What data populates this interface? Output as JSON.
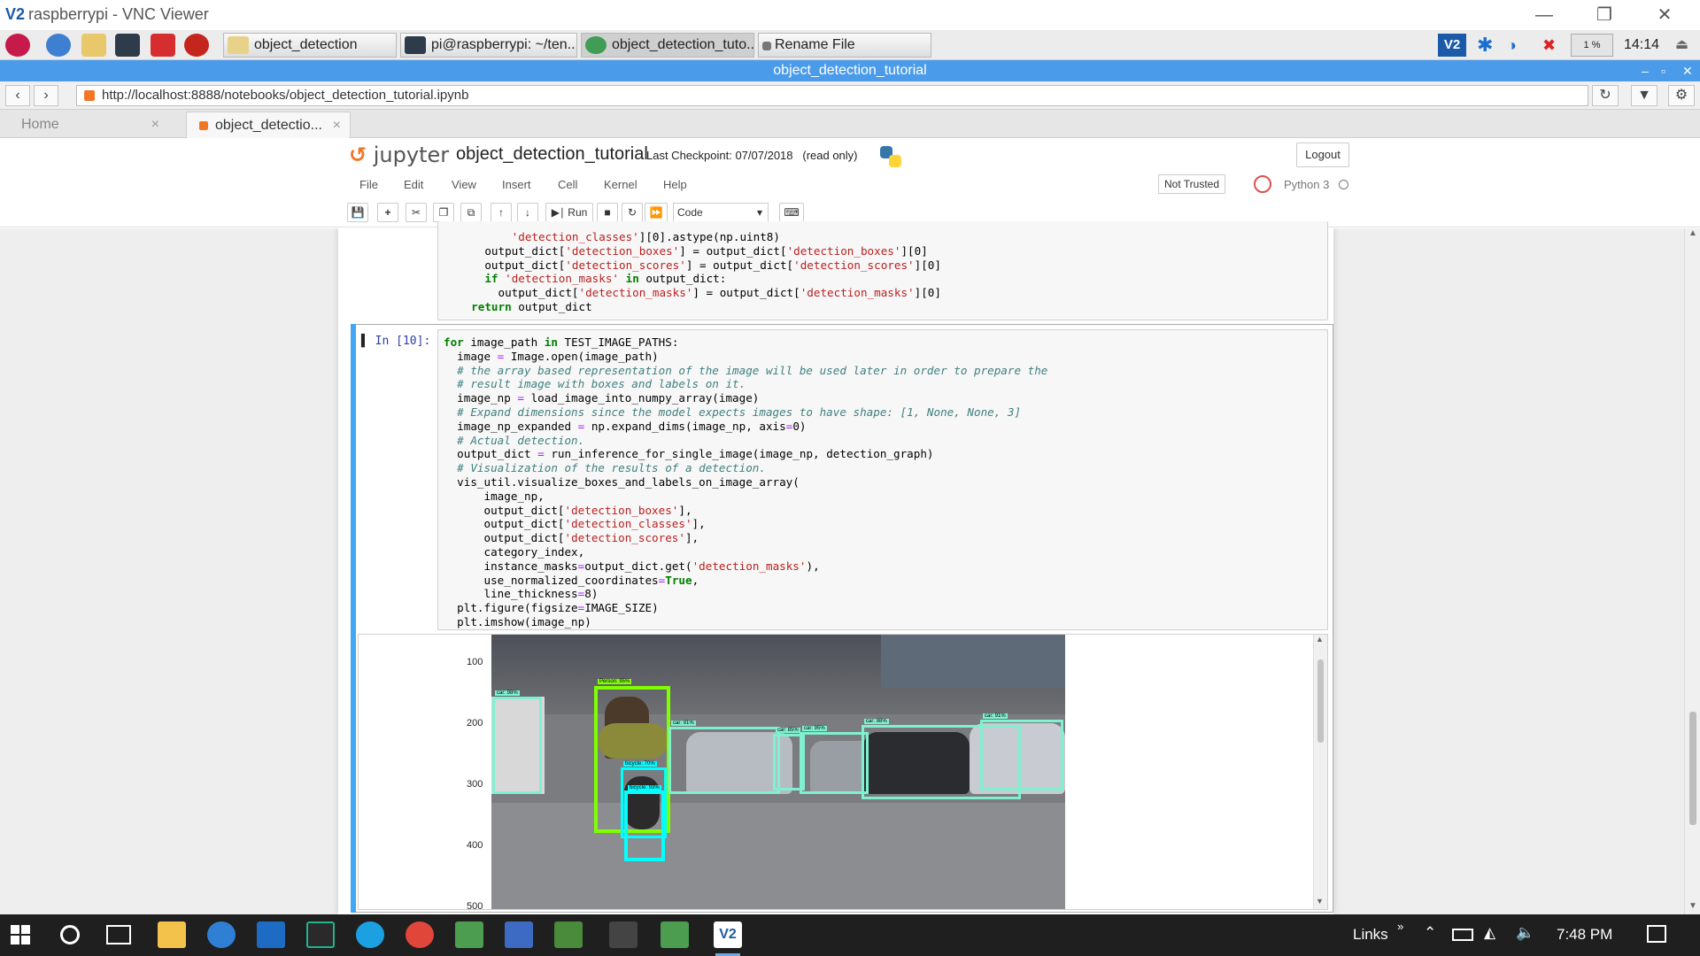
{
  "vnc": {
    "title": "raspberrypi - VNC Viewer",
    "logo": "V2"
  },
  "pi_taskbar": {
    "tasks": [
      {
        "label": "object_detection",
        "icon": "folder-icon"
      },
      {
        "label": "pi@raspberrypi: ~/ten...",
        "icon": "terminal-icon"
      },
      {
        "label": "object_detection_tuto...",
        "icon": "browser-icon"
      },
      {
        "label": "Rename File",
        "icon": "dialog-icon"
      }
    ],
    "cpu": "1 %",
    "clock": "14:14"
  },
  "browser": {
    "window_title": "object_detection_tutorial",
    "url": "http://localhost:8888/notebooks/object_detection_tutorial.ipynb",
    "tabs": [
      {
        "label": "Home"
      },
      {
        "label": "object_detectio..."
      }
    ]
  },
  "jupyter": {
    "logo": "jupyter",
    "notebook_name": "object_detection_tutorial",
    "checkpoint": "Last Checkpoint: 07/07/2018",
    "read_only": "(read only)",
    "logout": "Logout",
    "menu": [
      "File",
      "Edit",
      "View",
      "Insert",
      "Cell",
      "Kernel",
      "Help"
    ],
    "not_trusted": "Not Trusted",
    "kernel": "Python 3",
    "toolbar": {
      "run": "Run",
      "cell_type": "Code"
    }
  },
  "cell_prev_lines": [
    [
      [
        "",
        "        ",
        ""
      ],
      [
        "s",
        "'detection_classes'"
      ],
      [
        "",
        "][0].astype(np.uint8)"
      ]
    ],
    [
      [
        "",
        "    output_dict["
      ],
      [
        "s",
        "'detection_boxes'"
      ],
      [
        "",
        "] = output_dict["
      ],
      [
        "s",
        "'detection_boxes'"
      ],
      [
        "",
        "][0]"
      ]
    ],
    [
      [
        "",
        "    output_dict["
      ],
      [
        "s",
        "'detection_scores'"
      ],
      [
        "",
        "] = output_dict["
      ],
      [
        "s",
        "'detection_scores'"
      ],
      [
        "",
        "][0]"
      ]
    ],
    [
      [
        "",
        "    "
      ],
      [
        "k",
        "if"
      ],
      [
        "",
        " "
      ],
      [
        "s",
        "'detection_masks'"
      ],
      [
        "",
        " "
      ],
      [
        "k",
        "in"
      ],
      [
        "",
        " output_dict:"
      ]
    ],
    [
      [
        "",
        "      output_dict["
      ],
      [
        "s",
        "'detection_masks'"
      ],
      [
        "",
        "] = output_dict["
      ],
      [
        "s",
        "'detection_masks'"
      ],
      [
        "",
        "][0]"
      ]
    ],
    [
      [
        "",
        "  "
      ],
      [
        "k",
        "return"
      ],
      [
        "",
        " output_dict"
      ]
    ]
  ],
  "cell_current": {
    "prompt": "In [10]:",
    "lines": [
      [
        [
          "k",
          "for"
        ],
        [
          "",
          " image_path "
        ],
        [
          "k",
          "in"
        ],
        [
          "",
          " TEST_IMAGE_PATHS:"
        ]
      ],
      [
        [
          "",
          "  image "
        ],
        [
          "o",
          "="
        ],
        [
          "",
          " Image.open(image_path)"
        ]
      ],
      [
        [
          "c",
          "  # the array based representation of the image will be used later in order to prepare the"
        ]
      ],
      [
        [
          "c",
          "  # result image with boxes and labels on it."
        ]
      ],
      [
        [
          "",
          "  image_np "
        ],
        [
          "o",
          "="
        ],
        [
          "",
          " load_image_into_numpy_array(image)"
        ]
      ],
      [
        [
          "c",
          "  # Expand dimensions since the model expects images to have shape: [1, None, None, 3]"
        ]
      ],
      [
        [
          "",
          "  image_np_expanded "
        ],
        [
          "o",
          "="
        ],
        [
          "",
          " np.expand_dims(image_np, axis"
        ],
        [
          "o",
          "="
        ],
        [
          "",
          "0)"
        ]
      ],
      [
        [
          "c",
          "  # Actual detection."
        ]
      ],
      [
        [
          "",
          "  output_dict "
        ],
        [
          "o",
          "="
        ],
        [
          "",
          " run_inference_for_single_image(image_np, detection_graph)"
        ]
      ],
      [
        [
          "c",
          "  # Visualization of the results of a detection."
        ]
      ],
      [
        [
          "",
          "  vis_util.visualize_boxes_and_labels_on_image_array("
        ]
      ],
      [
        [
          "",
          "      image_np,"
        ]
      ],
      [
        [
          "",
          "      output_dict["
        ],
        [
          "s",
          "'detection_boxes'"
        ],
        [
          "",
          "],"
        ]
      ],
      [
        [
          "",
          "      output_dict["
        ],
        [
          "s",
          "'detection_classes'"
        ],
        [
          "",
          "],"
        ]
      ],
      [
        [
          "",
          "      output_dict["
        ],
        [
          "s",
          "'detection_scores'"
        ],
        [
          "",
          "],"
        ]
      ],
      [
        [
          "",
          "      category_index,"
        ]
      ],
      [
        [
          "",
          "      instance_masks"
        ],
        [
          "o",
          "="
        ],
        [
          "",
          "output_dict.get("
        ],
        [
          "s",
          "'detection_masks'"
        ],
        [
          "",
          "),"
        ]
      ],
      [
        [
          "",
          "      use_normalized_coordinates"
        ],
        [
          "o",
          "="
        ],
        [
          "k",
          "True"
        ],
        [
          "",
          ","
        ]
      ],
      [
        [
          "",
          "      line_thickness"
        ],
        [
          "o",
          "="
        ],
        [
          "",
          "8)"
        ]
      ],
      [
        [
          "",
          "  plt.figure(figsize"
        ],
        [
          "o",
          "="
        ],
        [
          "",
          "IMAGE_SIZE)"
        ]
      ],
      [
        [
          "",
          "  plt.imshow(image_np)"
        ]
      ]
    ]
  },
  "output": {
    "yticks": [
      "100",
      "200",
      "300",
      "400",
      "500"
    ],
    "detections": [
      {
        "label": "car: 98%",
        "color": "#7ff0d0"
      },
      {
        "label": "Person: 95%",
        "color": "#7fff00"
      },
      {
        "label": "car: 91%",
        "color": "#7ff0d0"
      },
      {
        "label": "bicycle: 70%",
        "color": "#00ffff"
      },
      {
        "label": "bicycle: 93%",
        "color": "#00ffff"
      },
      {
        "label": "car: 85%",
        "color": "#7ff0d0"
      },
      {
        "label": "car: 95%",
        "color": "#7ff0d0"
      },
      {
        "label": "car: 98%",
        "color": "#7ff0d0"
      },
      {
        "label": "car: 91%",
        "color": "#7ff0d0"
      }
    ]
  },
  "win_taskbar": {
    "links": "Links",
    "clock": "7:48 PM"
  },
  "colors": {
    "accent": "#4a9bea",
    "cell_selected": "#42a5f5",
    "jupyter_orange": "#f37626",
    "windows_taskbar": "#1f1f1f"
  }
}
